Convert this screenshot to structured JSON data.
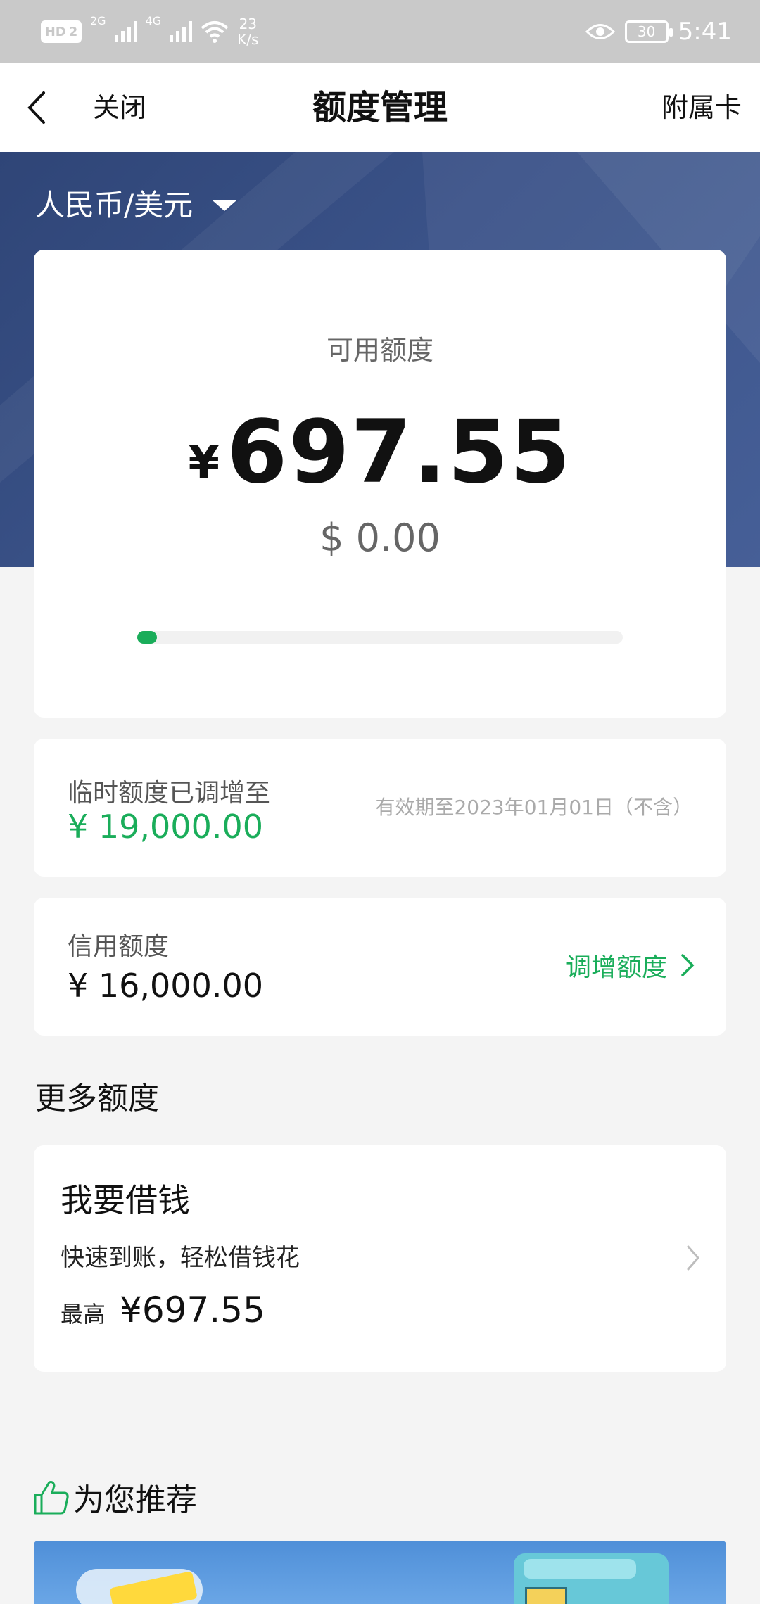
{
  "status_bar": {
    "hd": "HD",
    "sim": "2",
    "net1": "2G",
    "net2": "4G",
    "speed_value": "23",
    "speed_unit": "K/s",
    "battery": "30",
    "time": "5:41"
  },
  "nav": {
    "close_label": "关闭",
    "title": "额度管理",
    "supplementary_card_label": "附属卡"
  },
  "currency_selector": {
    "label": "人民币/美元"
  },
  "available": {
    "label": "可用额度",
    "symbol": "¥",
    "amount": "697.55",
    "usd": "$ 0.00",
    "progress_fraction": 0.04
  },
  "temporary_limit": {
    "label": "临时额度已调增至",
    "amount": "¥ 19,000.00",
    "validity": "有效期至2023年01月01日（不含）"
  },
  "credit_limit": {
    "label": "信用额度",
    "amount": "¥ 16,000.00",
    "action_label": "调增额度"
  },
  "more_limits": {
    "heading": "更多额度",
    "loan": {
      "title": "我要借钱",
      "description": "快速到账，轻松借钱花",
      "max_label": "最高",
      "max_amount": "¥697.55"
    }
  },
  "recommend": {
    "heading": "为您推荐"
  },
  "colors": {
    "accent_green": "#1aad5a",
    "hero_blue": "#3a5288",
    "status_bar_gray": "#c9c9c9"
  }
}
